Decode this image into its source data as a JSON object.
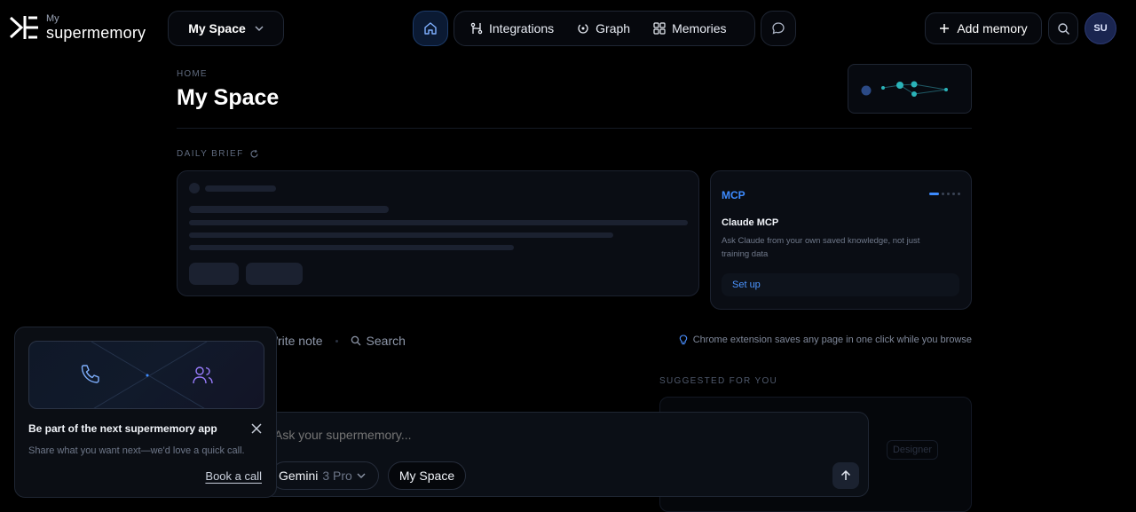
{
  "brand": {
    "my": "My",
    "name": "supermemory"
  },
  "header": {
    "space_select": "My Space",
    "nav": [
      {
        "label": "Integrations",
        "icon": "integrations-icon"
      },
      {
        "label": "Graph",
        "icon": "graph-icon"
      },
      {
        "label": "Memories",
        "icon": "grid-icon"
      }
    ],
    "add_memory": "Add memory",
    "avatar_initials": "SU"
  },
  "main": {
    "breadcrumb": "HOME",
    "title": "My Space",
    "daily_brief_label": "DAILY BRIEF",
    "mcp_card": {
      "tag": "MCP",
      "title": "Claude MCP",
      "description": "Ask Claude from your own saved knowledge, not just training data",
      "button": "Set up",
      "pager_total": 5,
      "pager_active": 1
    },
    "actions": {
      "write_note": "Write note",
      "search": "Search"
    },
    "hint": "Chrome extension saves any page in one click while you browse",
    "suggested_label": "SUGGESTED FOR YOU",
    "suggested_tag": "Designer"
  },
  "chat": {
    "placeholder": "Ask your supermemory...",
    "model_name": "Gemini",
    "model_version": "3 Pro",
    "space": "My Space"
  },
  "popup": {
    "title": "Be part of the next supermemory app",
    "description": "Share what you want next—we'd love a quick call.",
    "link": "Book a call"
  },
  "colors": {
    "accent": "#3d8bff",
    "background": "#000000",
    "avatar_bg": "#1a2550"
  }
}
